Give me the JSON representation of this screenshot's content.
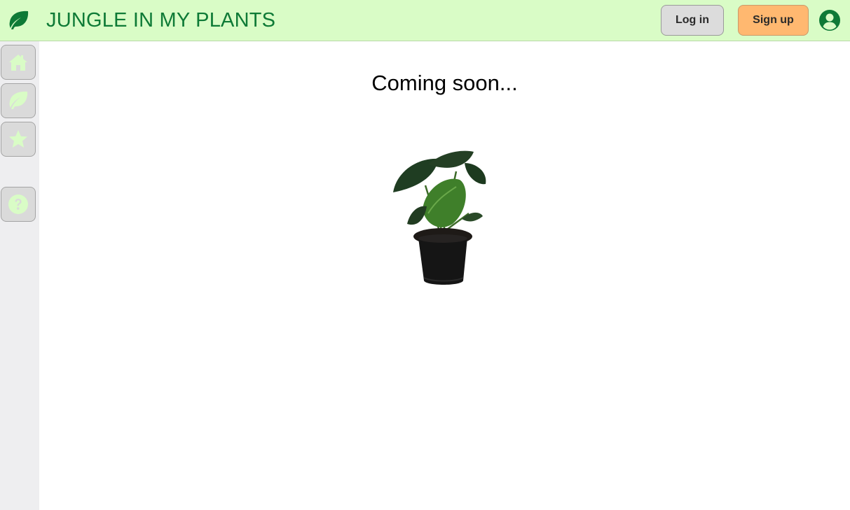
{
  "header": {
    "brand_icon": "leaf-icon",
    "title": "JUNGLE IN MY PLANTS",
    "login_label": "Log in",
    "signup_label": "Sign up",
    "account_icon": "user-circle-icon"
  },
  "sidebar": {
    "items": [
      {
        "icon": "home-icon"
      },
      {
        "icon": "leaf-icon"
      },
      {
        "icon": "star-icon"
      },
      {
        "icon": "question-circle-icon"
      }
    ]
  },
  "main": {
    "heading": "Coming soon...",
    "image": "potted-plant-image"
  },
  "colors": {
    "header_bg": "#d9fcc6",
    "brand_green": "#0e7a36",
    "signup_bg": "#ffb870",
    "login_bg": "#dcdcdc",
    "sidebar_bg": "#eeeef0",
    "sidebar_icon": "#d9fcc6"
  }
}
